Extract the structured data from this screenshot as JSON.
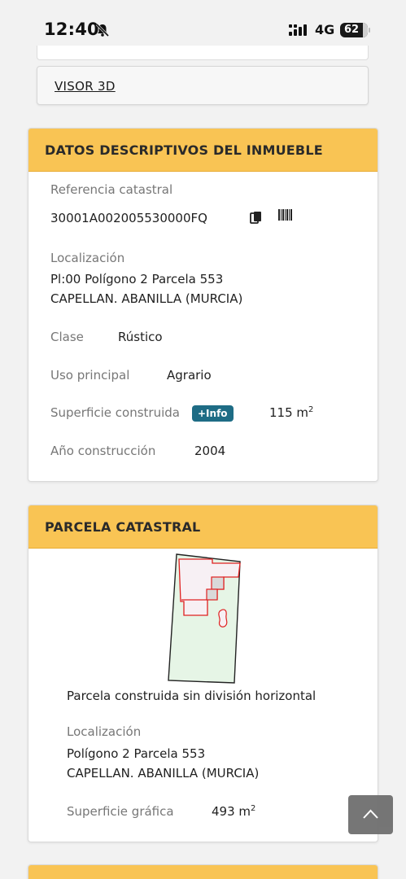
{
  "status_bar": {
    "time": "12:40",
    "network": "4G",
    "battery": "62",
    "icons": [
      "bell-muted-icon",
      "signal-icon"
    ]
  },
  "visor": {
    "label": "VISOR 3D"
  },
  "descriptive": {
    "title": "DATOS DESCRIPTIVOS DEL INMUEBLE",
    "ref_label": "Referencia catastral",
    "ref_value": "30001A002005530000FQ",
    "loc_label": "Localización",
    "loc_line1": "Pl:00 Polígono 2 Parcela 553",
    "loc_line2": "CAPELLAN. ABANILLA (MURCIA)",
    "clase_label": "Clase",
    "clase_value": "Rústico",
    "uso_label": "Uso principal",
    "uso_value": "Agrario",
    "sup_label": "Superficie construida",
    "sup_badge": "+Info",
    "sup_value": "115 m",
    "sup_unit_exp": "2",
    "anio_label": "Año construcción",
    "anio_value": "2004"
  },
  "parcel": {
    "title": "PARCELA CATASTRAL",
    "caption": "Parcela construida sin división horizontal",
    "loc_label": "Localización",
    "loc_line1": "Polígono 2 Parcela 553",
    "loc_line2": "CAPELLAN. ABANILLA (MURCIA)",
    "sup_label": "Superficie gráfica",
    "sup_value": "493 m",
    "sup_unit_exp": "2"
  },
  "colors": {
    "header": "#f9c454",
    "badge": "#1e6c85",
    "parcel_fill": "#e6f5e6",
    "building_line": "#e02020"
  }
}
